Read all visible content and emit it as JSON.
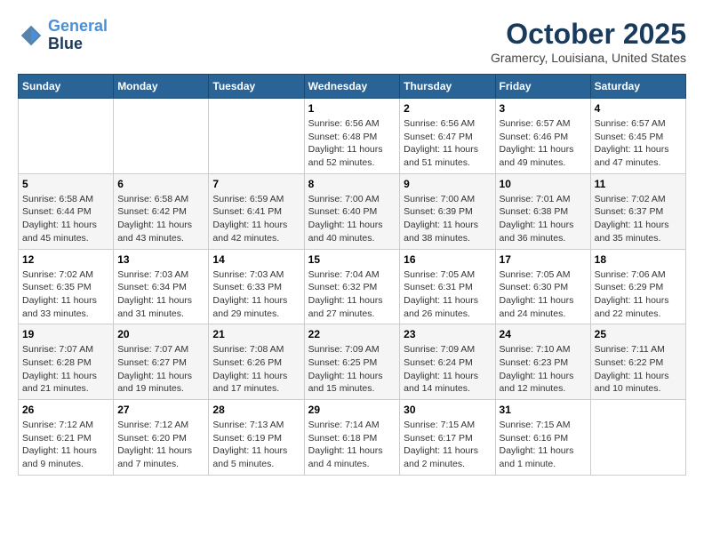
{
  "header": {
    "logo_line1": "General",
    "logo_line2": "Blue",
    "month": "October 2025",
    "location": "Gramercy, Louisiana, United States"
  },
  "weekdays": [
    "Sunday",
    "Monday",
    "Tuesday",
    "Wednesday",
    "Thursday",
    "Friday",
    "Saturday"
  ],
  "weeks": [
    [
      {
        "day": "",
        "info": ""
      },
      {
        "day": "",
        "info": ""
      },
      {
        "day": "",
        "info": ""
      },
      {
        "day": "1",
        "info": "Sunrise: 6:56 AM\nSunset: 6:48 PM\nDaylight: 11 hours and 52 minutes."
      },
      {
        "day": "2",
        "info": "Sunrise: 6:56 AM\nSunset: 6:47 PM\nDaylight: 11 hours and 51 minutes."
      },
      {
        "day": "3",
        "info": "Sunrise: 6:57 AM\nSunset: 6:46 PM\nDaylight: 11 hours and 49 minutes."
      },
      {
        "day": "4",
        "info": "Sunrise: 6:57 AM\nSunset: 6:45 PM\nDaylight: 11 hours and 47 minutes."
      }
    ],
    [
      {
        "day": "5",
        "info": "Sunrise: 6:58 AM\nSunset: 6:44 PM\nDaylight: 11 hours and 45 minutes."
      },
      {
        "day": "6",
        "info": "Sunrise: 6:58 AM\nSunset: 6:42 PM\nDaylight: 11 hours and 43 minutes."
      },
      {
        "day": "7",
        "info": "Sunrise: 6:59 AM\nSunset: 6:41 PM\nDaylight: 11 hours and 42 minutes."
      },
      {
        "day": "8",
        "info": "Sunrise: 7:00 AM\nSunset: 6:40 PM\nDaylight: 11 hours and 40 minutes."
      },
      {
        "day": "9",
        "info": "Sunrise: 7:00 AM\nSunset: 6:39 PM\nDaylight: 11 hours and 38 minutes."
      },
      {
        "day": "10",
        "info": "Sunrise: 7:01 AM\nSunset: 6:38 PM\nDaylight: 11 hours and 36 minutes."
      },
      {
        "day": "11",
        "info": "Sunrise: 7:02 AM\nSunset: 6:37 PM\nDaylight: 11 hours and 35 minutes."
      }
    ],
    [
      {
        "day": "12",
        "info": "Sunrise: 7:02 AM\nSunset: 6:35 PM\nDaylight: 11 hours and 33 minutes."
      },
      {
        "day": "13",
        "info": "Sunrise: 7:03 AM\nSunset: 6:34 PM\nDaylight: 11 hours and 31 minutes."
      },
      {
        "day": "14",
        "info": "Sunrise: 7:03 AM\nSunset: 6:33 PM\nDaylight: 11 hours and 29 minutes."
      },
      {
        "day": "15",
        "info": "Sunrise: 7:04 AM\nSunset: 6:32 PM\nDaylight: 11 hours and 27 minutes."
      },
      {
        "day": "16",
        "info": "Sunrise: 7:05 AM\nSunset: 6:31 PM\nDaylight: 11 hours and 26 minutes."
      },
      {
        "day": "17",
        "info": "Sunrise: 7:05 AM\nSunset: 6:30 PM\nDaylight: 11 hours and 24 minutes."
      },
      {
        "day": "18",
        "info": "Sunrise: 7:06 AM\nSunset: 6:29 PM\nDaylight: 11 hours and 22 minutes."
      }
    ],
    [
      {
        "day": "19",
        "info": "Sunrise: 7:07 AM\nSunset: 6:28 PM\nDaylight: 11 hours and 21 minutes."
      },
      {
        "day": "20",
        "info": "Sunrise: 7:07 AM\nSunset: 6:27 PM\nDaylight: 11 hours and 19 minutes."
      },
      {
        "day": "21",
        "info": "Sunrise: 7:08 AM\nSunset: 6:26 PM\nDaylight: 11 hours and 17 minutes."
      },
      {
        "day": "22",
        "info": "Sunrise: 7:09 AM\nSunset: 6:25 PM\nDaylight: 11 hours and 15 minutes."
      },
      {
        "day": "23",
        "info": "Sunrise: 7:09 AM\nSunset: 6:24 PM\nDaylight: 11 hours and 14 minutes."
      },
      {
        "day": "24",
        "info": "Sunrise: 7:10 AM\nSunset: 6:23 PM\nDaylight: 11 hours and 12 minutes."
      },
      {
        "day": "25",
        "info": "Sunrise: 7:11 AM\nSunset: 6:22 PM\nDaylight: 11 hours and 10 minutes."
      }
    ],
    [
      {
        "day": "26",
        "info": "Sunrise: 7:12 AM\nSunset: 6:21 PM\nDaylight: 11 hours and 9 minutes."
      },
      {
        "day": "27",
        "info": "Sunrise: 7:12 AM\nSunset: 6:20 PM\nDaylight: 11 hours and 7 minutes."
      },
      {
        "day": "28",
        "info": "Sunrise: 7:13 AM\nSunset: 6:19 PM\nDaylight: 11 hours and 5 minutes."
      },
      {
        "day": "29",
        "info": "Sunrise: 7:14 AM\nSunset: 6:18 PM\nDaylight: 11 hours and 4 minutes."
      },
      {
        "day": "30",
        "info": "Sunrise: 7:15 AM\nSunset: 6:17 PM\nDaylight: 11 hours and 2 minutes."
      },
      {
        "day": "31",
        "info": "Sunrise: 7:15 AM\nSunset: 6:16 PM\nDaylight: 11 hours and 1 minute."
      },
      {
        "day": "",
        "info": ""
      }
    ]
  ]
}
